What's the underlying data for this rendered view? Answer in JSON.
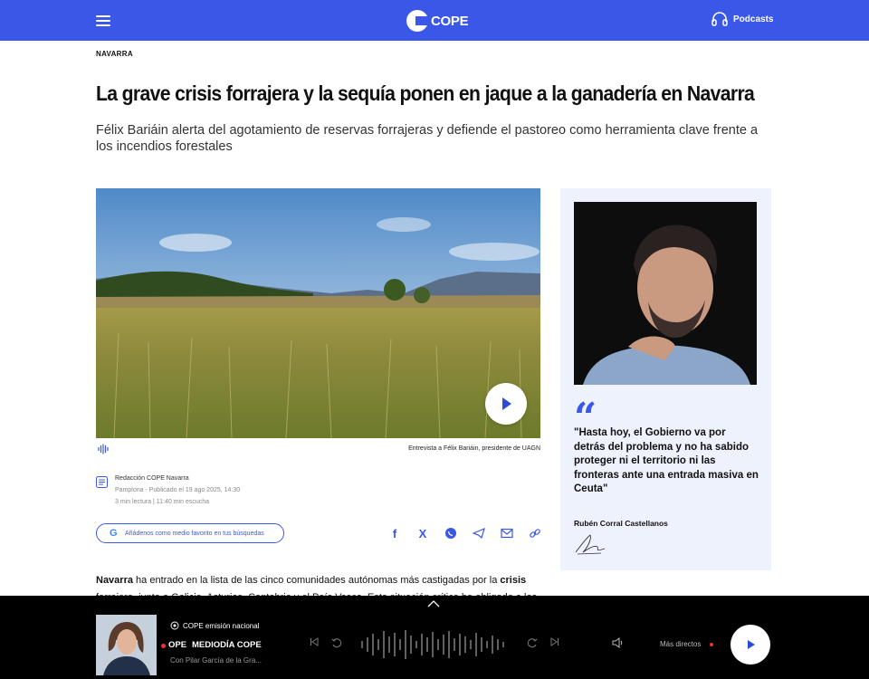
{
  "header": {
    "logo_text": "COPE",
    "podcasts_label": "Podcasts",
    "bg_color": "#3a57e8"
  },
  "article": {
    "section": "NAVARRA",
    "title": "La grave crisis forrajera y la sequía ponen en jaque a la ganadería en Navarra",
    "subtitle": "Félix Bariáin alerta del agotamiento de reservas forrajeras y defiende el pastoreo como herramienta clave frente a los incendios forestales",
    "image_caption": "Entrevista a Félix Bariáin, presidente de UAGN",
    "author": "Redacción COPE Navarra",
    "published": "Pamplona - Publicado el 19 ago 2025, 14:30",
    "reading": "3 min lectura | 11:40 min escucha",
    "google_label": "Añádenos como medio favorito en tus búsquedas",
    "body_p1": "Navarra",
    "body_p2": " ha entrado en la lista de las cinco comunidades autónomas más castigadas por la ",
    "body_p3": "crisis",
    "body_p4": "forrajera, junto a Galicia, Asturias, Cantabria y el País Vasco. Esta situación crítica ha obligado a los"
  },
  "share": {
    "facebook": "f",
    "x": "X",
    "whatsapp": "whatsapp-icon",
    "telegram": "telegram-icon",
    "email": "mail-icon",
    "link": "link-icon"
  },
  "sidebar": {
    "quote": "\"Hasta hoy, el Gobierno va por detrás del problema y no ha sabido proteger ni el territorio ni las fronteras ante una entrada masiva en Ceuta\"",
    "quote_author": "Rubén Corral Castellanos",
    "quote_mark": "“"
  },
  "player": {
    "emision": "COPE emisión nacional",
    "station": "OPE",
    "program": "MEDIODÍA COPE",
    "hosts": "Con Pilar García de la Gra...",
    "mas_directos": "Más directos"
  }
}
